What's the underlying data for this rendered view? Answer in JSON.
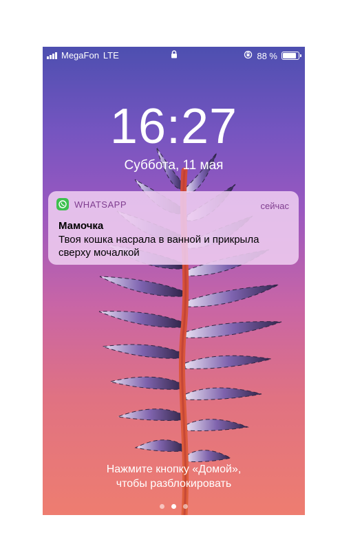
{
  "status": {
    "carrier": "MegaFon",
    "network": "LTE",
    "battery_text": "88 %",
    "battery_level": 0.88
  },
  "lock": {
    "time": "16:27",
    "date": "Суббота, 11 мая"
  },
  "notification": {
    "app": "WHATSAPP",
    "time": "сейчас",
    "title": "Мамочка",
    "body": "Твоя кошка насрала в ванной и прикрыла сверху мочалкой"
  },
  "unlock": {
    "line1": "Нажмите кнопку «Домой»,",
    "line2": "чтобы разблокировать"
  },
  "pager": {
    "count": 3,
    "active_index": 1
  },
  "colors": {
    "notification_accent": "#7f3d8f",
    "whatsapp_green": "#3dc04e"
  }
}
